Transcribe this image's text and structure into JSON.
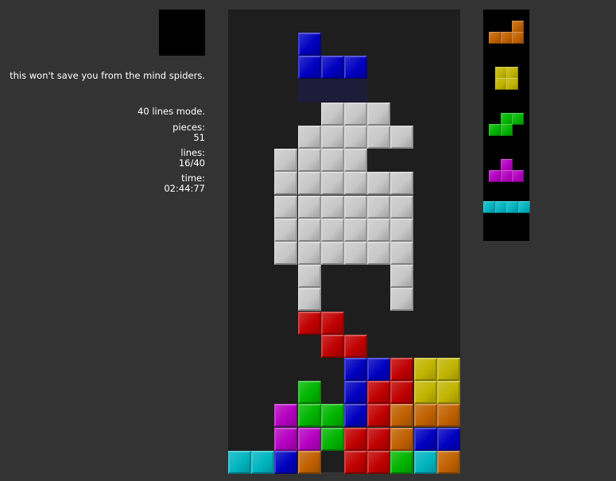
{
  "colors": {
    "background": "#333333",
    "board": "#1e1e1e",
    "panel": "#000000",
    "pieces": {
      "I": "#00b4c0",
      "O": "#c0b400",
      "T": "#b400c0",
      "S": "#00b400",
      "Z": "#c00000",
      "J": "#0000c0",
      "L": "#c06000",
      "G": "#c8c8c8"
    }
  },
  "info": {
    "message": "this won't save you from the mind spiders.",
    "mode": "40 lines mode.",
    "pieces_label": "pieces:",
    "pieces_value": "51",
    "lines_label": "lines:",
    "lines_value": "16/40",
    "time_label": "time:",
    "time_value": "02:44:77"
  },
  "board": {
    "cols": 10,
    "rows": 20,
    "rows_map": [
      "...J......",
      "...JJJ....",
      "...gggg...",
      "....GGG...",
      "...GGGGG..",
      "..GGGG....",
      "..GGGGGG..",
      "..GGGGGG..",
      "..GGGGGG..",
      "..GGGGGG..",
      "...G...G..",
      "...G...G..",
      "...ZZ.....",
      "....ZZ....",
      "......JJZOO",
      "...S..JZZOO",
      "..TSS.JZLLL",
      "..TTS.ZZLJJ",
      "IIJL.ZZSIL"
    ],
    "grid": [
      "...J......",
      "...JJJ....",
      "...ggg....",
      "....GGG...",
      "...GGGGG..",
      "..GGGG....",
      "..GGGGGG..",
      "..GGGGGG..",
      "..GGGGGG..",
      "..GGGGGG..",
      "...G...G..",
      "...G...G..",
      "...ZZ.....",
      "....ZZ....",
      ".....JJZOO",
      "...S.JZZOO",
      "..TSSJZLLL",
      "..TTSZZLJJ",
      "IIJL.ZZSIL"
    ]
  },
  "next_queue": [
    "L",
    "O",
    "S",
    "T",
    "I"
  ]
}
